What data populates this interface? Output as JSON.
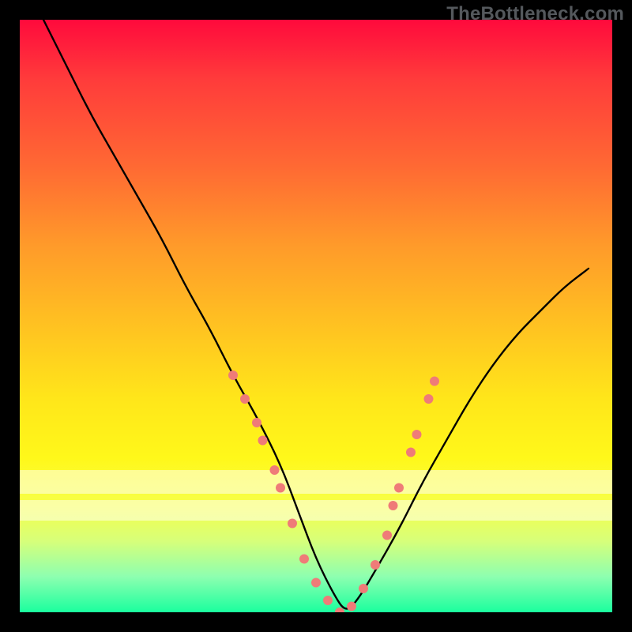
{
  "watermark": {
    "text": "TheBottleneck.com"
  },
  "chart_data": {
    "type": "line",
    "title": "",
    "xlabel": "",
    "ylabel": "",
    "xlim": [
      0,
      100
    ],
    "ylim": [
      0,
      100
    ],
    "grid": false,
    "background": {
      "gradient": "vertical",
      "stops": [
        {
          "pos": 0.0,
          "color": "#ff0a3c"
        },
        {
          "pos": 0.5,
          "color": "#ffc321"
        },
        {
          "pos": 0.8,
          "color": "#fff81a"
        },
        {
          "pos": 1.0,
          "color": "#1aff9e"
        }
      ],
      "pale_bands_y": [
        80,
        84
      ]
    },
    "series": [
      {
        "name": "bottleneck-curve",
        "color": "#000000",
        "x": [
          4,
          8,
          12,
          16,
          20,
          24,
          28,
          32,
          36,
          40,
          44,
          47,
          50,
          53,
          55,
          57,
          60,
          64,
          68,
          72,
          76,
          80,
          84,
          88,
          92,
          96
        ],
        "y": [
          100,
          92,
          84,
          77,
          70,
          63,
          55,
          48,
          40,
          33,
          25,
          17,
          9,
          3,
          0,
          2,
          7,
          14,
          22,
          29,
          36,
          42,
          47,
          51,
          55,
          58
        ]
      }
    ],
    "markers": {
      "name": "sample-points",
      "color": "#ef7b78",
      "radius": 6,
      "points": [
        {
          "x": 36,
          "y": 40
        },
        {
          "x": 38,
          "y": 36
        },
        {
          "x": 40,
          "y": 32
        },
        {
          "x": 41,
          "y": 29
        },
        {
          "x": 43,
          "y": 24
        },
        {
          "x": 44,
          "y": 21
        },
        {
          "x": 46,
          "y": 15
        },
        {
          "x": 48,
          "y": 9
        },
        {
          "x": 50,
          "y": 5
        },
        {
          "x": 52,
          "y": 2
        },
        {
          "x": 54,
          "y": 0
        },
        {
          "x": 56,
          "y": 1
        },
        {
          "x": 58,
          "y": 4
        },
        {
          "x": 60,
          "y": 8
        },
        {
          "x": 62,
          "y": 13
        },
        {
          "x": 63,
          "y": 18
        },
        {
          "x": 64,
          "y": 21
        },
        {
          "x": 66,
          "y": 27
        },
        {
          "x": 67,
          "y": 30
        },
        {
          "x": 69,
          "y": 36
        },
        {
          "x": 70,
          "y": 39
        }
      ]
    }
  }
}
